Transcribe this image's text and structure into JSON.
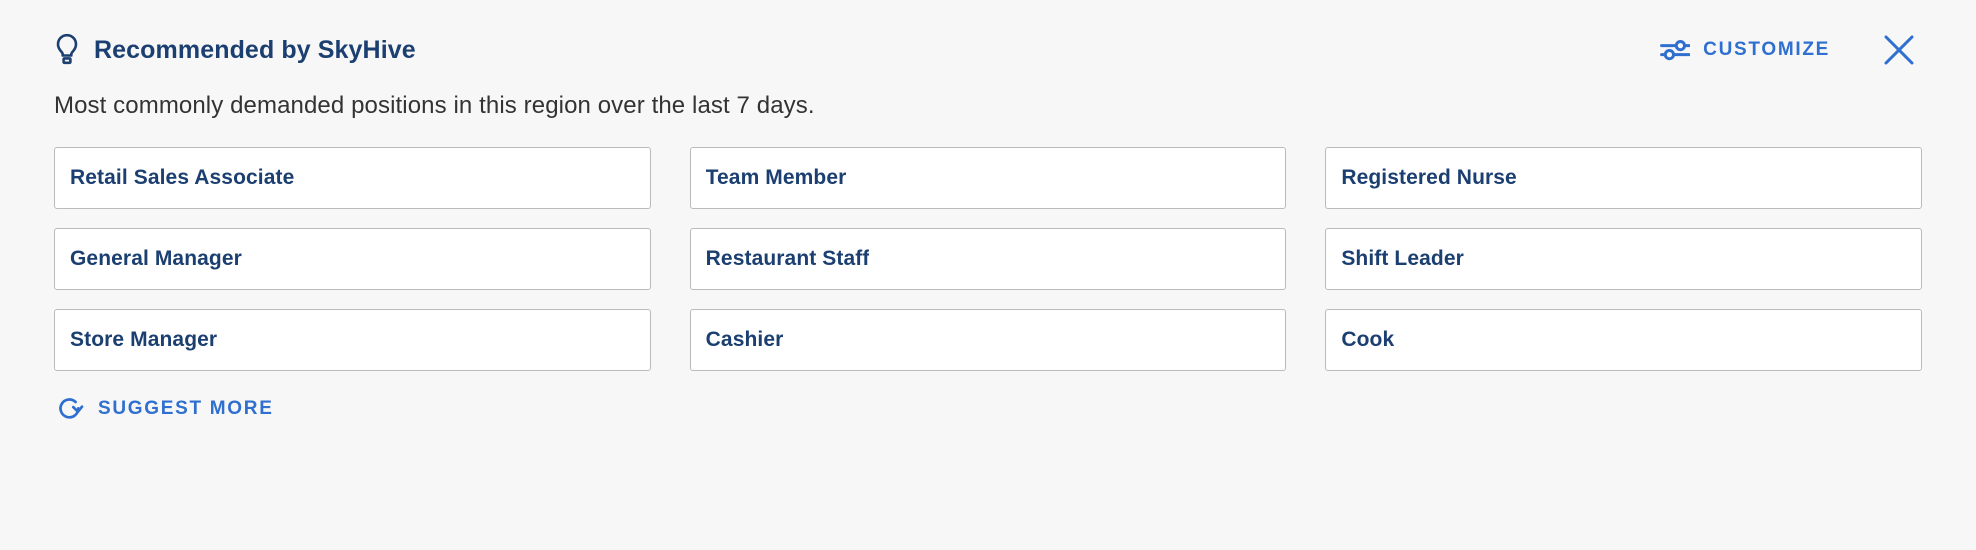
{
  "header": {
    "title": "Recommended by SkyHive",
    "bulb_icon": "lightbulb-icon",
    "customize_label": "CUSTOMIZE",
    "customize_icon": "tune-sliders-icon",
    "close_icon": "close-icon"
  },
  "subtitle": "Most commonly demanded positions in this region over the last 7 days.",
  "positions": [
    {
      "label": "Retail Sales Associate"
    },
    {
      "label": "Team Member"
    },
    {
      "label": "Registered Nurse"
    },
    {
      "label": "General Manager"
    },
    {
      "label": "Restaurant Staff"
    },
    {
      "label": "Shift Leader"
    },
    {
      "label": "Store Manager"
    },
    {
      "label": "Cashier"
    },
    {
      "label": "Cook"
    }
  ],
  "footer": {
    "suggest_label": "SUGGEST MORE",
    "suggest_icon": "refresh-rotate-icon"
  },
  "colors": {
    "page_background": "#f7f7f7",
    "card_background": "#ffffff",
    "card_border": "#b9bbbd",
    "navy_text": "#1b3f70",
    "accent_blue": "#2f6fd0",
    "body_text": "#333333"
  }
}
